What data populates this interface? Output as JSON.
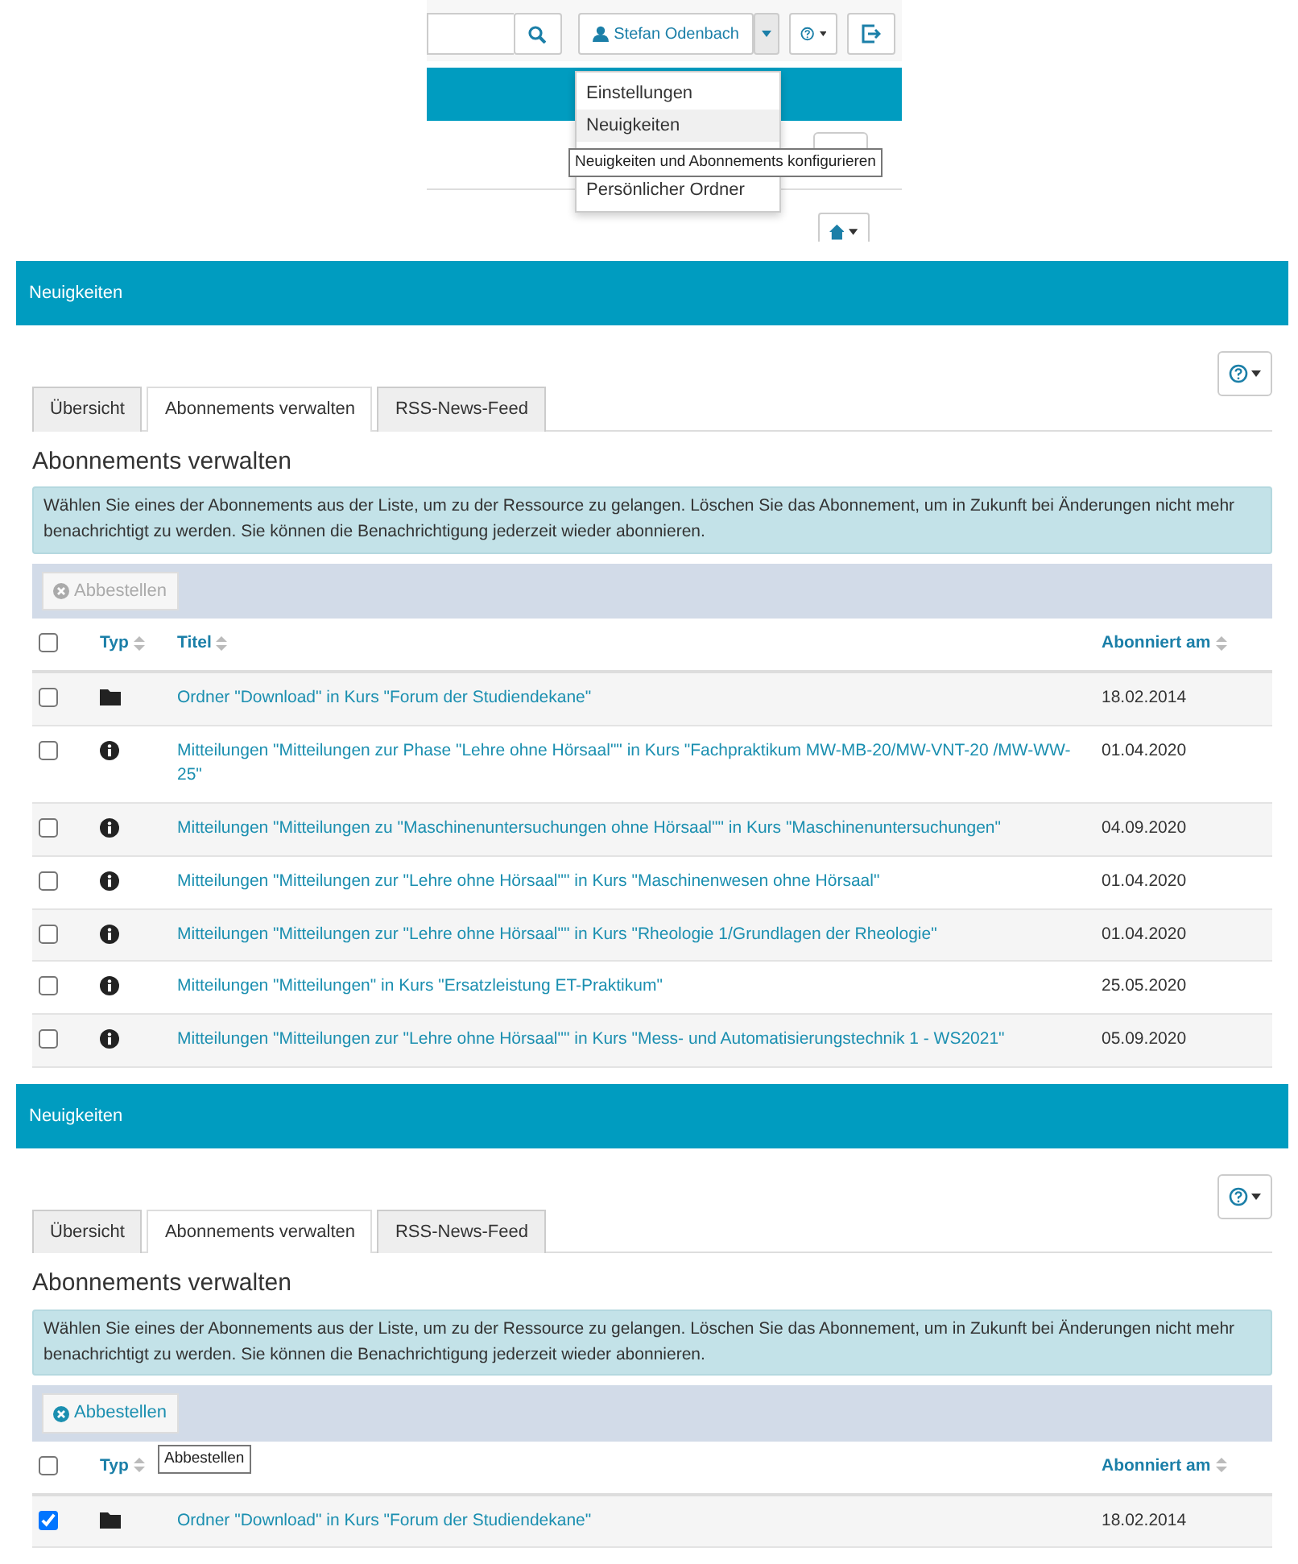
{
  "header_crop": {
    "user_button": {
      "label": "Stefan Odenbach"
    },
    "menu": [
      {
        "label": "Einstellungen",
        "hovered": false
      },
      {
        "label": "Neuigkeiten",
        "hovered": true
      },
      {
        "label": "Persönlicher Ordner",
        "hovered": false
      }
    ],
    "tooltip": "Neuigkeiten und Abonnements konfigurieren"
  },
  "page_view_1": {
    "title": "Neuigkeiten",
    "tabs": [
      {
        "label": "Übersicht",
        "selected": false
      },
      {
        "label": "Abonnements verwalten",
        "selected": true
      },
      {
        "label": "RSS-News-Feed",
        "selected": false
      }
    ],
    "heading": "Abonnements verwalten",
    "info": "Wählen Sie eines der Abonnements aus der Liste, um zu der Ressource zu gelangen. Löschen Sie das Abonnement, um in Zukunft bei Änderungen nicht mehr benachrichtigt zu werden. Sie können die Benachrichtigung jederzeit wieder abonnieren.",
    "action_button": {
      "label": "Abbestellen",
      "disabled": true
    },
    "select_all": {
      "checked": false
    },
    "columns": [
      "Typ",
      "Titel",
      "Abonniert am"
    ],
    "rows": [
      {
        "kind": "folder",
        "title": "Ordner \"Download\" in Kurs \"Forum der Studiendekane\"",
        "date": "18.02.2014",
        "checked": false
      },
      {
        "kind": "info",
        "title": "Mitteilungen \"Mitteilungen zur Phase \"Lehre ohne Hörsaal\"\" in Kurs \"Fachpraktikum MW-MB-20/MW-VNT-20 /MW-WW-25\"",
        "date": "01.04.2020",
        "checked": false
      },
      {
        "kind": "info",
        "title": "Mitteilungen \"Mitteilungen zu \"Maschinenuntersuchungen ohne Hörsaal\"\" in Kurs \"Maschinenuntersuchungen\"",
        "date": "04.09.2020",
        "checked": false
      },
      {
        "kind": "info",
        "title": "Mitteilungen \"Mitteilungen zur \"Lehre ohne Hörsaal\"\" in Kurs \"Maschinenwesen ohne Hörsaal\"",
        "date": "01.04.2020",
        "checked": false
      },
      {
        "kind": "info",
        "title": "Mitteilungen \"Mitteilungen zur \"Lehre ohne Hörsaal\"\" in Kurs \"Rheologie 1/Grundlagen der Rheologie\"",
        "date": "01.04.2020",
        "checked": false
      },
      {
        "kind": "info",
        "title": "Mitteilungen \"Mitteilungen\" in Kurs \"Ersatzleistung ET-Praktikum\"",
        "date": "25.05.2020",
        "checked": false
      },
      {
        "kind": "info",
        "title": "Mitteilungen \"Mitteilungen zur \"Lehre ohne Hörsaal\"\" in Kurs \"Mess- und Automatisierungstechnik 1 - WS2021\"",
        "date": "05.09.2020",
        "checked": false
      }
    ]
  },
  "page_view_2": {
    "title": "Neuigkeiten",
    "tabs": [
      {
        "label": "Übersicht",
        "selected": false
      },
      {
        "label": "Abonnements verwalten",
        "selected": true
      },
      {
        "label": "RSS-News-Feed",
        "selected": false
      }
    ],
    "heading": "Abonnements verwalten",
    "info": "Wählen Sie eines der Abonnements aus der Liste, um zu der Ressource zu gelangen. Löschen Sie das Abonnement, um in Zukunft bei Änderungen nicht mehr benachrichtigt zu werden. Sie können die Benachrichtigung jederzeit wieder abonnieren.",
    "action_button": {
      "label": "Abbestellen",
      "disabled": false
    },
    "tooltip": "Abbestellen",
    "select_all": {
      "checked": false
    },
    "columns": [
      "Typ",
      "Abonniert am"
    ],
    "rows": [
      {
        "kind": "folder",
        "title": "Ordner \"Download\" in Kurs \"Forum der Studiendekane\"",
        "date": "18.02.2014",
        "checked": true
      }
    ]
  }
}
